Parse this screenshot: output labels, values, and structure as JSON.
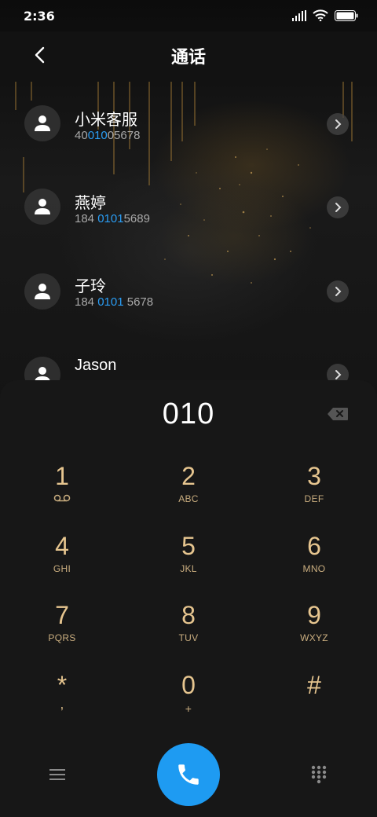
{
  "status": {
    "time": "2:36"
  },
  "header": {
    "title": "通话"
  },
  "contacts": [
    {
      "name": "小米客服",
      "number_pre": "40",
      "number_hl": "010",
      "number_post": "05678"
    },
    {
      "name": "燕婷",
      "number_pre": "184 ",
      "number_hl": "0101",
      "number_post": "5689"
    },
    {
      "name": "子玲",
      "number_pre": "184 ",
      "number_hl": "0101",
      "number_post": " 5678"
    },
    {
      "name": "Jason",
      "number_pre": "",
      "number_hl": "",
      "number_post": ""
    }
  ],
  "dialpad": {
    "entered_number": "010",
    "keys": [
      {
        "digit": "1",
        "letters": "voicemail-icon"
      },
      {
        "digit": "2",
        "letters": "ABC"
      },
      {
        "digit": "3",
        "letters": "DEF"
      },
      {
        "digit": "4",
        "letters": "GHI"
      },
      {
        "digit": "5",
        "letters": "JKL"
      },
      {
        "digit": "6",
        "letters": "MNO"
      },
      {
        "digit": "7",
        "letters": "PQRS"
      },
      {
        "digit": "8",
        "letters": "TUV"
      },
      {
        "digit": "9",
        "letters": "WXYZ"
      },
      {
        "digit": "*",
        "letters": ","
      },
      {
        "digit": "0",
        "letters": "+"
      },
      {
        "digit": "#",
        "letters": ""
      }
    ]
  },
  "icons": {
    "back": "chevron-left-icon",
    "backspace": "backspace-icon",
    "menu": "menu-icon",
    "call": "phone-icon",
    "keypad": "keypad-icon"
  },
  "colors": {
    "accent": "#1e9bf2",
    "key_digit": "#e6c58f",
    "highlight": "#2a9df4"
  }
}
